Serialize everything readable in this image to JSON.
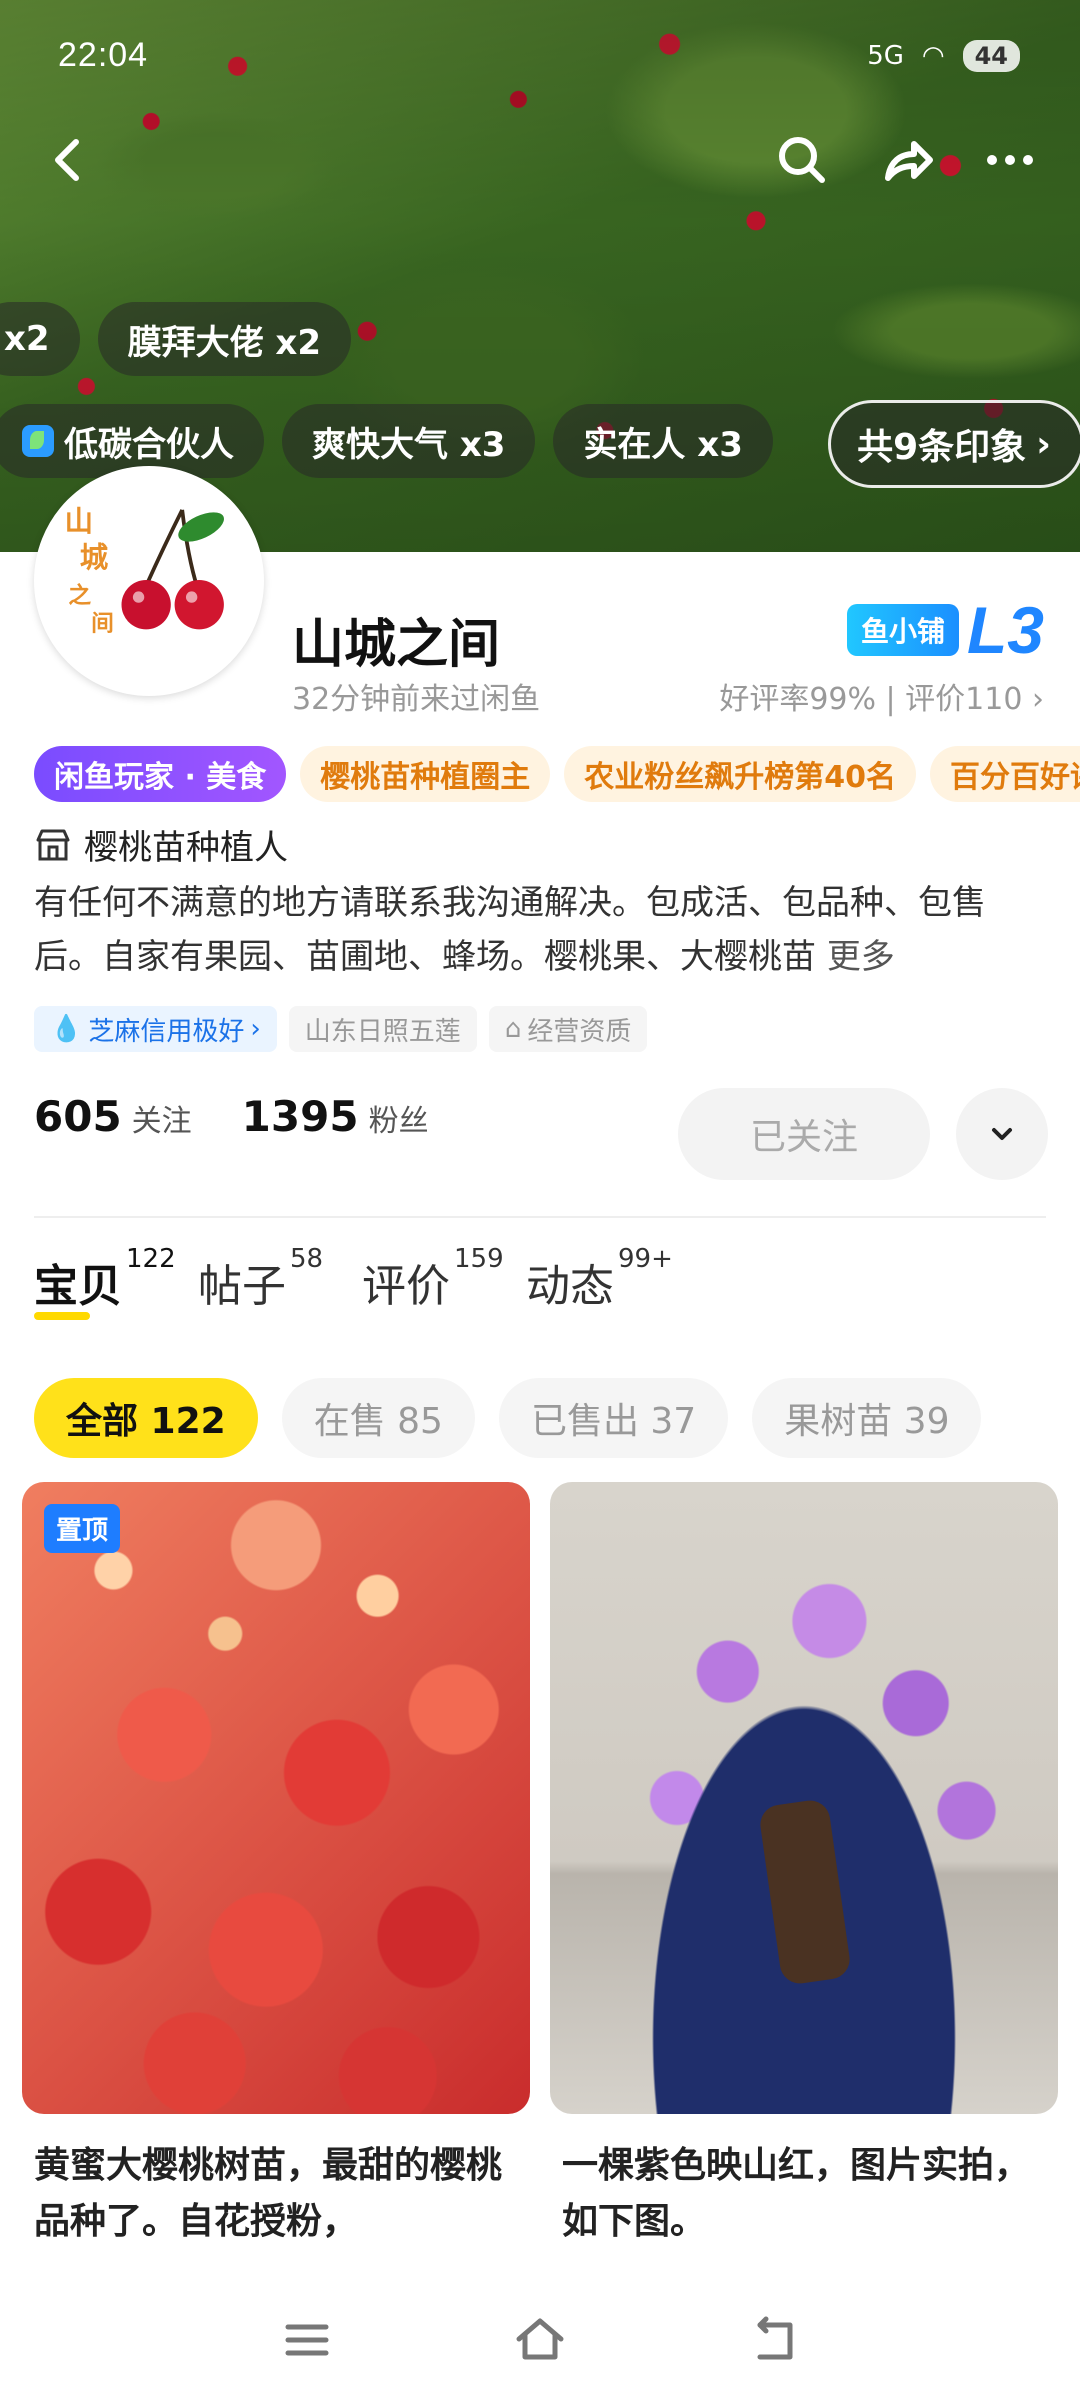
{
  "status_bar": {
    "time": "22:04",
    "signal": "5G",
    "battery": "44"
  },
  "hero": {
    "tags_row1": [
      {
        "label": "x2"
      },
      {
        "label": "膜拜大佬 x2"
      }
    ],
    "tags_row2": [
      {
        "label": "低碳合伙人"
      },
      {
        "label": "爽快大气 x3"
      },
      {
        "label": "实在人 x3"
      }
    ],
    "impression_button": "共9条印象",
    "icons": {
      "back": "back-arrow-icon",
      "search": "search-icon",
      "share": "share-icon",
      "more": "more-icon"
    }
  },
  "profile": {
    "shop_name": "山城之间",
    "last_seen": "32分钟前来过闲鱼",
    "shop_badge": "鱼小铺",
    "level": "L3",
    "rating": "好评率99% | 评价110",
    "honors": [
      {
        "label": "闲鱼玩家 · 美食",
        "style": "primary"
      },
      {
        "label": "樱桃苗种植圈主",
        "style": "gold"
      },
      {
        "label": "农业粉丝飙升榜第40名",
        "style": "gold"
      },
      {
        "label": "百分百好评",
        "style": "gold"
      }
    ],
    "category": "樱桃苗种植人",
    "description": "有任何不满意的地方请联系我沟通解决。包成活、包品种、包售后。自家有果园、苗圃地、蜂场。樱桃果、大樱桃苗",
    "more_label": "更多",
    "credit": "芝麻信用极好",
    "location": "山东日照五莲",
    "license": "经营资质",
    "following_count": "605",
    "following_label": "关注",
    "followers_count": "1395",
    "followers_label": "粉丝",
    "follow_button": "已关注"
  },
  "tabs": [
    {
      "label": "宝贝",
      "count": "122"
    },
    {
      "label": "帖子",
      "count": "58"
    },
    {
      "label": "评价",
      "count": "159"
    },
    {
      "label": "动态",
      "count": "99+"
    }
  ],
  "filters": [
    {
      "label": "全部 122"
    },
    {
      "label": "在售 85"
    },
    {
      "label": "已售出 37"
    },
    {
      "label": "果树苗 39"
    }
  ],
  "products": [
    {
      "badge": "置顶",
      "title": "黄蜜大樱桃树苗，最甜的樱桃品种了。自花授粉，"
    },
    {
      "title": "一棵紫色映山红，图片实拍，如下图。"
    }
  ],
  "colors": {
    "accent_yellow": "#ffe11a",
    "brand_blue": "#1f86ff",
    "honor_purple": "#8a50ff",
    "gold_text": "#e07b0d"
  }
}
